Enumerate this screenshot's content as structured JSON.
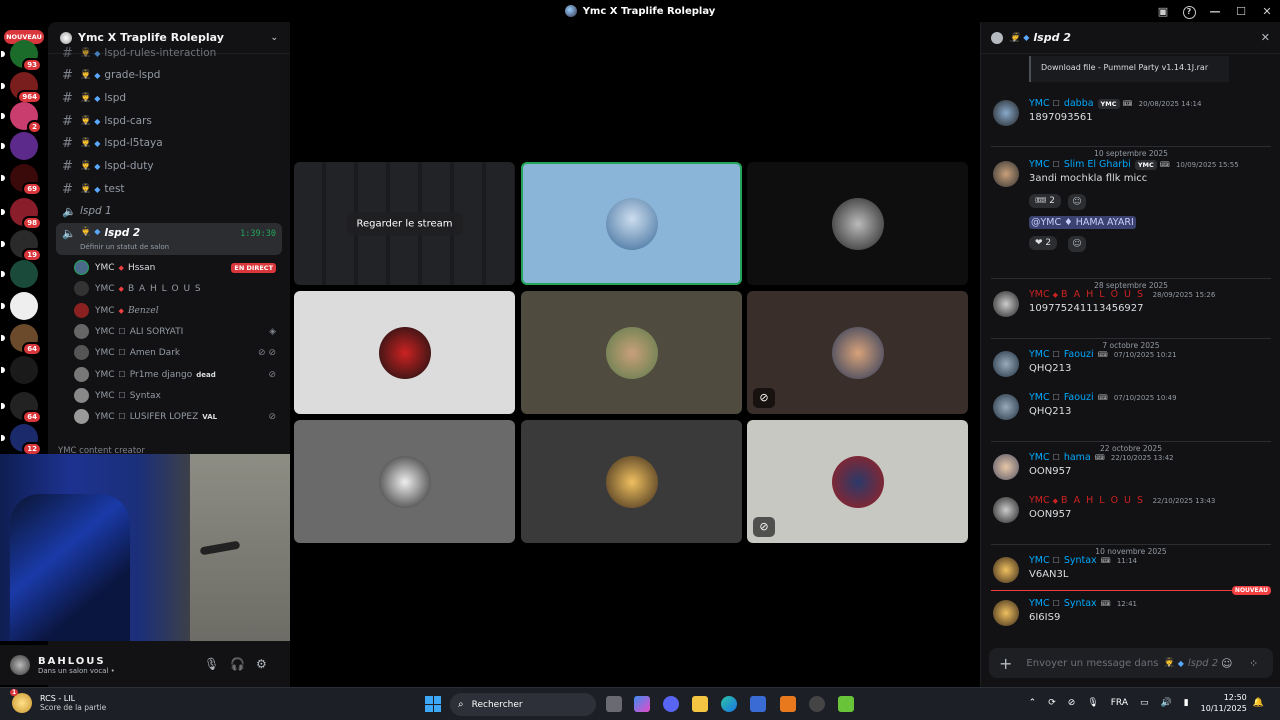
{
  "window": {
    "title": "Ymc X Traplife Roleplay"
  },
  "rail": {
    "nouveau": "NOUVEAU",
    "badges": [
      "93",
      "964",
      "2",
      "69",
      "98",
      "19",
      "64",
      "64",
      "12"
    ]
  },
  "sidebar": {
    "guild_name": "Ymc X Traplife Roleplay",
    "channels": [
      {
        "name": "lspd-rules-interaction"
      },
      {
        "name": "grade-lspd"
      },
      {
        "name": "lspd"
      },
      {
        "name": "lspd-cars"
      },
      {
        "name": "lspd-l5taya"
      },
      {
        "name": "lspd-duty"
      },
      {
        "name": "test"
      }
    ],
    "voice_channels": [
      {
        "name": "lspd 1"
      },
      {
        "name": "lspd 2",
        "timer": "1:39:30",
        "status": "Définir un statut de salon"
      }
    ],
    "voice_users": [
      {
        "prefix": "YMC",
        "name": "Hssan",
        "badge": "EN DIRECT"
      },
      {
        "prefix": "YMC",
        "name": "B A H L O U S"
      },
      {
        "prefix": "YMC",
        "name": "Benzel"
      },
      {
        "prefix": "YMC",
        "name": "ALI SORYATI"
      },
      {
        "prefix": "YMC",
        "name": "Amen Dark"
      },
      {
        "prefix": "YMC",
        "name": "Pr1me django",
        "tag": "dead"
      },
      {
        "prefix": "YMC",
        "name": "Syntax"
      },
      {
        "prefix": "YMC",
        "name": "LUSIFER LOPEZ",
        "tag": "VAL"
      }
    ],
    "category": "YMC content creator"
  },
  "user_panel": {
    "name": "BAHLOUS",
    "status": "Dans un salon vocal •"
  },
  "stage": {
    "stream_button": "Regarder le stream"
  },
  "chat": {
    "header": "lspd 2",
    "file": "Download file - Pummel Party v1.14.1J.rar",
    "messages": [
      {
        "prefix": "YMC",
        "name": "dabba",
        "tag": "YMC",
        "time": "20/08/2025 14:14",
        "text": "1897093561"
      },
      {
        "prefix": "YMC",
        "name": "Slim El Gharbi",
        "tag": "YMC",
        "time": "10/09/2025 15:55",
        "text": "3andi mochkla fllk micc",
        "reaction_count": "2"
      },
      {
        "mention": "@YMC ♦ HAMA AYARI",
        "reaction_count": "2"
      },
      {
        "prefix": "YMC",
        "name": "B A H L O U S",
        "time": "28/09/2025 15:26",
        "text": "109775241113456927"
      },
      {
        "prefix": "YMC",
        "name": "Faouzi",
        "time": "07/10/2025 10:21",
        "text": "QHQ213"
      },
      {
        "prefix": "YMC",
        "name": "Faouzi",
        "time": "07/10/2025 10:49",
        "text": "QHQ213"
      },
      {
        "prefix": "YMC",
        "name": "hama",
        "time": "22/10/2025 13:42",
        "text": "OON957"
      },
      {
        "prefix": "YMC",
        "name": "B A H L O U S",
        "time": "22/10/2025 13:43",
        "text": "OON957"
      },
      {
        "prefix": "YMC",
        "name": "Syntax",
        "time": "11:14",
        "text": "V6AN3L"
      },
      {
        "prefix": "YMC",
        "name": "Syntax",
        "time": "12:41",
        "text": "6I6IS9"
      }
    ],
    "dividers": [
      "10 septembre 2025",
      "28 septembre 2025",
      "7 octobre 2025",
      "22 octobre 2025",
      "10 novembre 2025"
    ],
    "new_label": "NOUVEAU",
    "composer_placeholder": "Envoyer un message dans",
    "composer_channel": "lspd 2"
  },
  "taskbar": {
    "notif_title": "RCS - LIL",
    "notif_sub": "Score de la partie",
    "notif_badge": "1",
    "search_placeholder": "Rechercher",
    "lang": "FRA",
    "time": "12:50",
    "date": "10/11/2025"
  },
  "colors": {
    "accent": "#5865f2",
    "live": "#da373c",
    "link": "#00a8fc",
    "speaking": "#23a55a"
  }
}
